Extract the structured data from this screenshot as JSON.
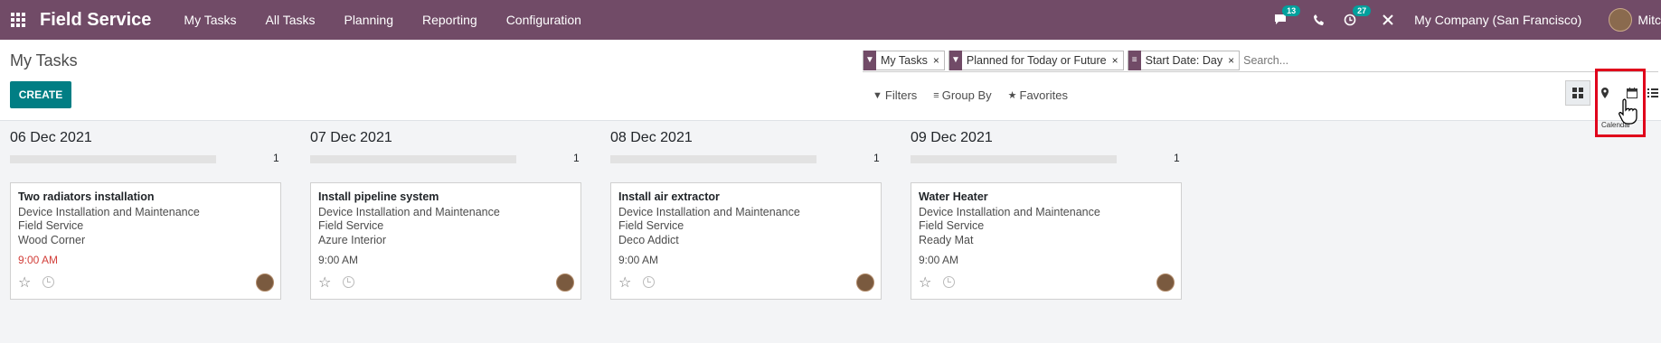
{
  "navbar": {
    "brand": "Field Service",
    "menu": [
      "My Tasks",
      "All Tasks",
      "Planning",
      "Reporting",
      "Configuration"
    ],
    "messages_count": "13",
    "activities_count": "27",
    "company": "My Company (San Francisco)",
    "user": "Mitc"
  },
  "control": {
    "title": "My Tasks",
    "create_label": "CREATE",
    "facets": [
      {
        "label": "My Tasks",
        "icon": "filter-icon"
      },
      {
        "label": "Planned for Today or Future",
        "icon": "filter-icon"
      },
      {
        "label": "Start Date: Day",
        "icon": "group-icon"
      }
    ],
    "search_placeholder": "Search...",
    "filters_label": "Filters",
    "groupby_label": "Group By",
    "favorites_label": "Favorites",
    "tooltip": "Calendar"
  },
  "columns": [
    {
      "title": "06 Dec 2021",
      "count": "1",
      "progress": 0,
      "card": {
        "title": "Two radiators installation",
        "project": "Device Installation and Maintenance",
        "type": "Field Service",
        "customer": "Wood Corner",
        "time": "9:00 AM",
        "overdue": true
      }
    },
    {
      "title": "07 Dec 2021",
      "count": "1",
      "progress": 0,
      "card": {
        "title": "Install pipeline system",
        "project": "Device Installation and Maintenance",
        "type": "Field Service",
        "customer": "Azure Interior",
        "time": "9:00 AM",
        "overdue": false
      }
    },
    {
      "title": "08 Dec 2021",
      "count": "1",
      "progress": 0,
      "card": {
        "title": "Install air extractor",
        "project": "Device Installation and Maintenance",
        "type": "Field Service",
        "customer": "Deco Addict",
        "time": "9:00 AM",
        "overdue": false
      }
    },
    {
      "title": "09 Dec 2021",
      "count": "1",
      "progress": 0,
      "card": {
        "title": "Water Heater",
        "project": "Device Installation and Maintenance",
        "type": "Field Service",
        "customer": "Ready Mat",
        "time": "9:00 AM",
        "overdue": false
      }
    }
  ],
  "colors": {
    "brand": "#714b67",
    "create": "#017e84",
    "highlight": "#e0001b",
    "overdue": "#d23f3a"
  }
}
